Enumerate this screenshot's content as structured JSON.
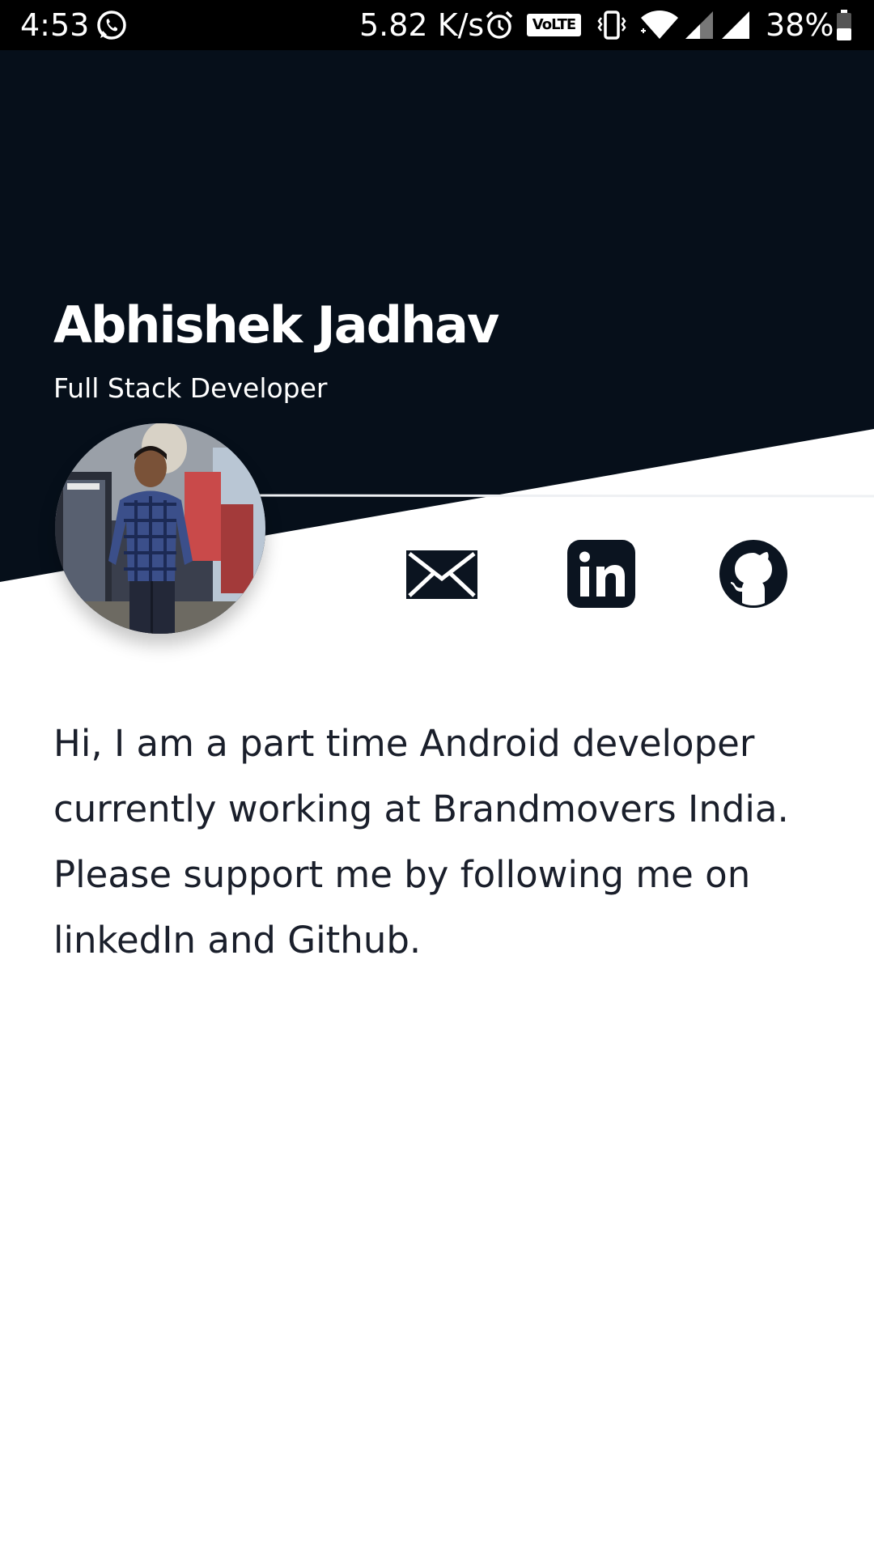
{
  "status_bar": {
    "time": "4:53",
    "network_speed": "5.82 K/s",
    "volte_label": "VoLTE",
    "battery_percent": "38%",
    "icons": [
      "whatsapp-icon",
      "alarm-icon",
      "volte-icon",
      "vibrate-icon",
      "wifi-icon",
      "signal-icon",
      "signal-icon",
      "battery-icon"
    ]
  },
  "profile": {
    "name": "Abhishek Jadhav",
    "role": "Full Stack Developer",
    "avatar_alt": "Profile photo"
  },
  "social": {
    "links": [
      {
        "icon": "mail-icon",
        "label": "Email"
      },
      {
        "icon": "linkedin-icon",
        "label": "LinkedIn"
      },
      {
        "icon": "github-icon",
        "label": "GitHub"
      }
    ]
  },
  "bio": {
    "text": "Hi, I am a part time Android developer currently working at Brandmovers India. Please support me by following me on linkedIn and Github."
  },
  "colors": {
    "header_bg": "#060f1a",
    "status_bar_bg": "#000000",
    "text_dark": "#1a1f2b",
    "icon_dark": "#0b1420",
    "background": "#ffffff"
  }
}
